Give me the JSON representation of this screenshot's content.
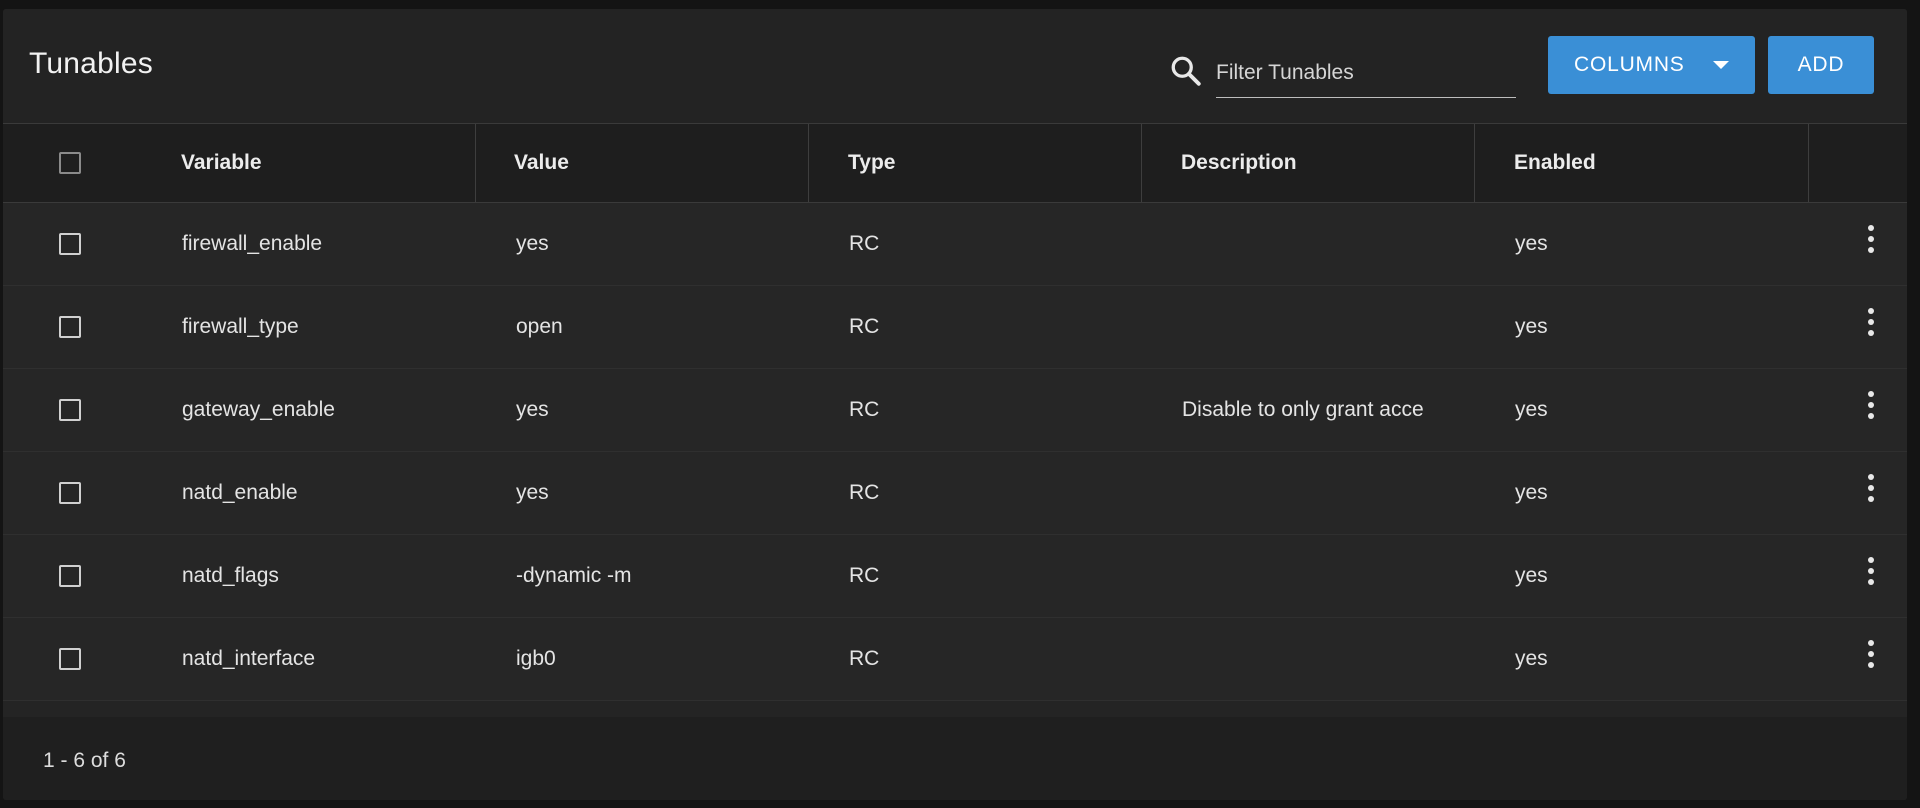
{
  "header": {
    "title": "Tunables",
    "filter_placeholder": "Filter Tunables",
    "filter_value": "",
    "columns_label": "COLUMNS",
    "add_label": "ADD"
  },
  "table": {
    "columns": [
      "Variable",
      "Value",
      "Type",
      "Description",
      "Enabled"
    ],
    "rows": [
      {
        "variable": "firewall_enable",
        "value": "yes",
        "type": "RC",
        "description": "",
        "enabled": "yes"
      },
      {
        "variable": "firewall_type",
        "value": "open",
        "type": "RC",
        "description": "",
        "enabled": "yes"
      },
      {
        "variable": "gateway_enable",
        "value": "yes",
        "type": "RC",
        "description": "Disable to only grant acce",
        "enabled": "yes"
      },
      {
        "variable": "natd_enable",
        "value": "yes",
        "type": "RC",
        "description": "",
        "enabled": "yes"
      },
      {
        "variable": "natd_flags",
        "value": "-dynamic -m",
        "type": "RC",
        "description": "",
        "enabled": "yes"
      },
      {
        "variable": "natd_interface",
        "value": "igb0",
        "type": "RC",
        "description": "",
        "enabled": "yes"
      }
    ]
  },
  "footer": {
    "pagination": "1 - 6 of 6"
  },
  "icons": {
    "search": "search-icon",
    "row_menu": "more-vert-icon",
    "columns_caret": "caret-down-icon"
  },
  "colors": {
    "accent": "#3a8fd6",
    "background": "#141414",
    "card": "#242424"
  }
}
